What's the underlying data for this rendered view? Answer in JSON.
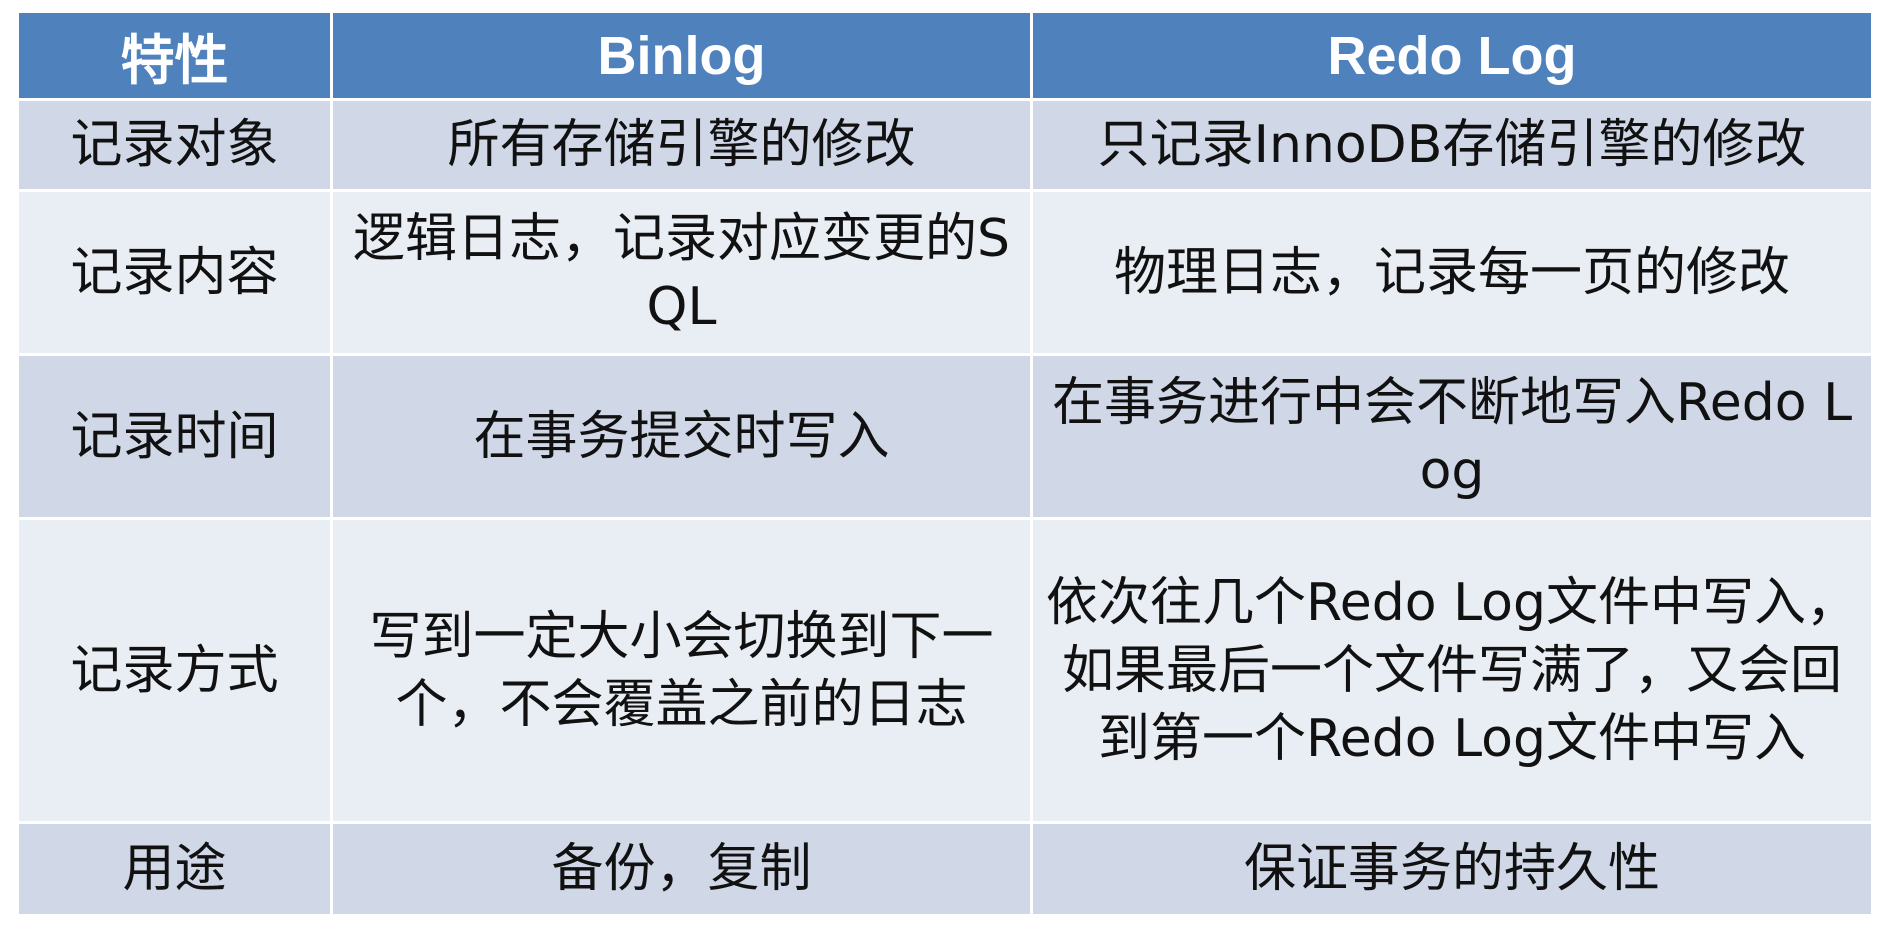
{
  "table": {
    "headers": [
      "特性",
      "Binlog",
      "Redo Log"
    ],
    "rows": [
      [
        "记录对象",
        "所有存储引擎的修改",
        "只记录InnoDB存储引擎的修改"
      ],
      [
        "记录内容",
        "逻辑日志，记录对应变更的SQL",
        "物理日志，记录每一页的修改"
      ],
      [
        "记录时间",
        "在事务提交时写入",
        "在事务进行中会不断地写入Redo Log"
      ],
      [
        "记录方式",
        "写到一定大小会切换到下一个，不会覆盖之前的日志",
        "依次往几个Redo Log文件中写入，如果最后一个文件写满了，又会回到第一个Redo Log文件中写入"
      ],
      [
        "用途",
        "备份，复制",
        "保证事务的持久性"
      ]
    ]
  },
  "colors": {
    "header_bg": "#4f81bd",
    "row_odd_bg": "#d0d8e8",
    "row_even_bg": "#e9edf4"
  }
}
